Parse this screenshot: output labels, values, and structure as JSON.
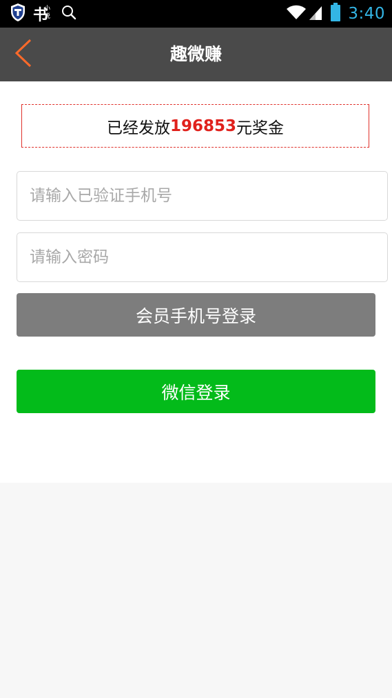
{
  "status_bar": {
    "time": "3:40",
    "app_logo": {
      "main": "书",
      "small_top": "小",
      "small_bottom": "说"
    },
    "icons": [
      "shield-icon",
      "book-app-icon",
      "search-icon",
      "wifi-icon",
      "signal-icon",
      "battery-icon"
    ],
    "clock_color": "#33b5e5"
  },
  "header": {
    "title": "趣微赚",
    "back_icon": "chevron-left-icon",
    "accent_color": "#ff6a2a"
  },
  "bonus": {
    "prefix": "已经发放",
    "amount": "196853",
    "suffix": "元奖金",
    "highlight_color": "#e0211c"
  },
  "form": {
    "phone": {
      "value": "",
      "placeholder": "请输入已验证手机号"
    },
    "password": {
      "value": "",
      "placeholder": "请输入密码"
    }
  },
  "buttons": {
    "member_login": "会员手机号登录",
    "wechat_login": "微信登录",
    "wechat_color": "#03bb1a"
  }
}
